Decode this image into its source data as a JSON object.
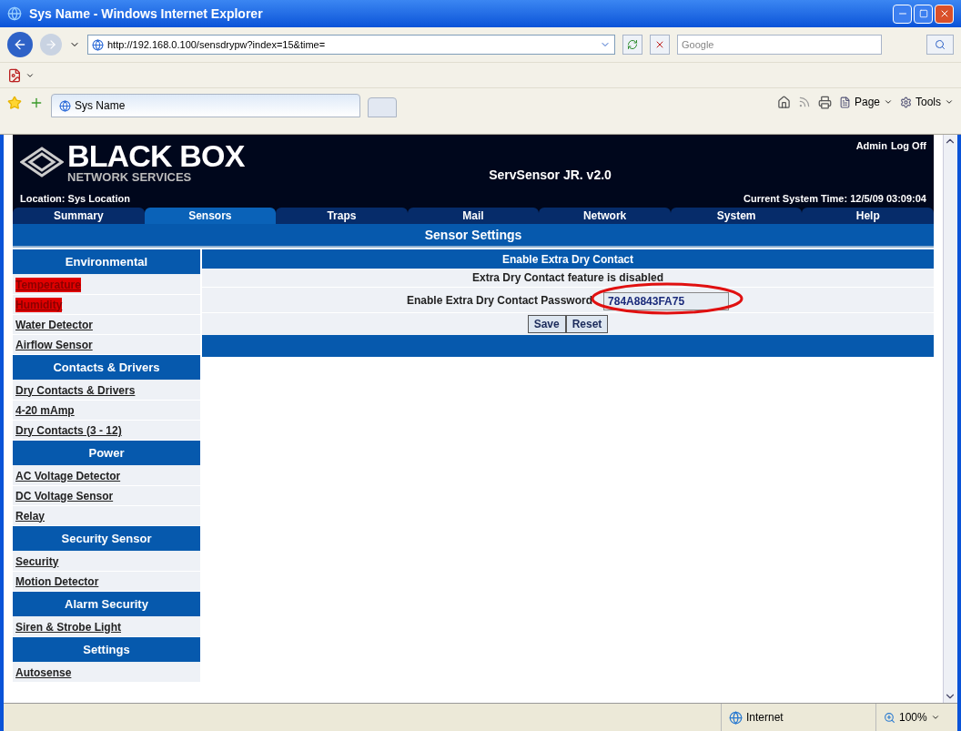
{
  "window": {
    "title": "Sys Name - Windows Internet Explorer"
  },
  "address_bar": {
    "url": "http://192.168.0.100/sensdrypw?index=15&time="
  },
  "search_field": {
    "placeholder": "Google"
  },
  "browser_tabs": [
    {
      "label": "Sys Name",
      "selected": true
    }
  ],
  "command_bar": [
    "Page",
    "Tools"
  ],
  "header": {
    "admin": "Admin",
    "log_off": "Log Off",
    "product": "ServSensor JR. v2.0",
    "location": "Location: Sys Location",
    "time": "Current System Time: 12/5/09 03:09:04",
    "logo_top": "BLACK BOX",
    "logo_bottom": "NETWORK SERVICES"
  },
  "nav_tabs": [
    {
      "label": "Summary",
      "selected": false
    },
    {
      "label": "Sensors",
      "selected": true
    },
    {
      "label": "Traps",
      "selected": false
    },
    {
      "label": "Mail",
      "selected": false
    },
    {
      "label": "Network",
      "selected": false
    },
    {
      "label": "System",
      "selected": false
    },
    {
      "label": "Help",
      "selected": false
    }
  ],
  "page_title": "Sensor Settings",
  "sidebar": [
    {
      "title": "Environmental",
      "items": [
        {
          "label": "Temperature",
          "alarm": true
        },
        {
          "label": "Humidity",
          "alarm": true
        },
        {
          "label": "Water Detector",
          "alarm": false
        },
        {
          "label": "Airflow Sensor",
          "alarm": false
        }
      ]
    },
    {
      "title": "Contacts & Drivers",
      "items": [
        {
          "label": "Dry Contacts & Drivers",
          "alarm": false
        },
        {
          "label": "4-20 mAmp",
          "alarm": false
        },
        {
          "label": "Dry Contacts (3 - 12)",
          "alarm": false
        }
      ]
    },
    {
      "title": "Power",
      "items": [
        {
          "label": "AC Voltage Detector",
          "alarm": false
        },
        {
          "label": "DC Voltage Sensor",
          "alarm": false
        },
        {
          "label": "Relay",
          "alarm": false
        }
      ]
    },
    {
      "title": "Security Sensor",
      "items": [
        {
          "label": "Security",
          "alarm": false
        },
        {
          "label": "Motion Detector",
          "alarm": false
        }
      ]
    },
    {
      "title": "Alarm Security",
      "items": [
        {
          "label": "Siren & Strobe Light",
          "alarm": false
        }
      ]
    },
    {
      "title": "Settings",
      "items": [
        {
          "label": "Autosense",
          "alarm": false
        }
      ]
    }
  ],
  "panel": {
    "title": "Enable Extra Dry Contact",
    "message": "Extra Dry Contact feature is disabled",
    "field_label": "Enable Extra Dry Contact Password",
    "field_value": "784A8843FA75",
    "buttons": [
      "Save",
      "Reset"
    ]
  },
  "status_bar": {
    "zone": "Internet",
    "zoom": "100%"
  }
}
